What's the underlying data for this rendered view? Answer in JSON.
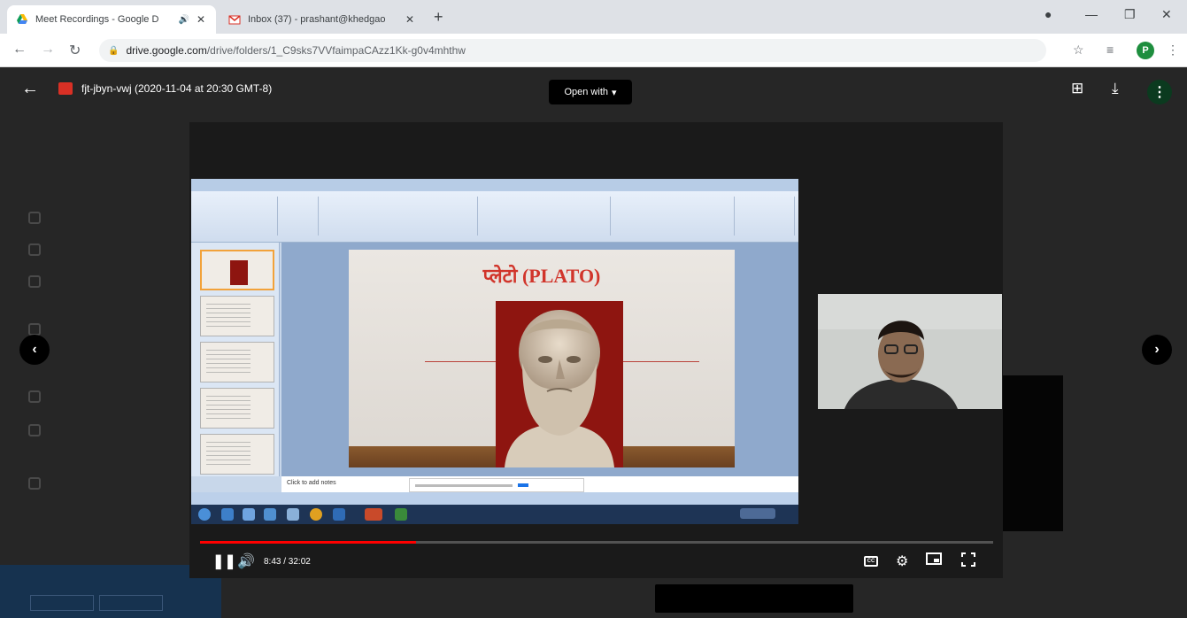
{
  "browser": {
    "tabs": [
      {
        "title": "Meet Recordings - Google D",
        "active": true,
        "audio_icon": "speaker-icon"
      },
      {
        "title": "Inbox (37) - prashant@khedgao",
        "active": false
      }
    ],
    "url_host": "drive.google.com",
    "url_path": "/drive/folders/1_C9sks7VVfaimpaCAzz1Kk-g0v4mhthw",
    "profile_initial": "P",
    "accent": "#1e8e3e"
  },
  "viewer": {
    "file_title": "fjt-jbyn-vwj (2020-11-04 at 20:30 GMT-8)",
    "open_with_label": "Open with"
  },
  "video": {
    "slide_title": "प्लेटो (PLATO)",
    "notes_placeholder": "Click to add notes",
    "current_time": "8:43",
    "duration": "32:02",
    "time_display": "8:43 / 32:02",
    "progress_fraction": 0.272,
    "cc_label": "CC"
  }
}
